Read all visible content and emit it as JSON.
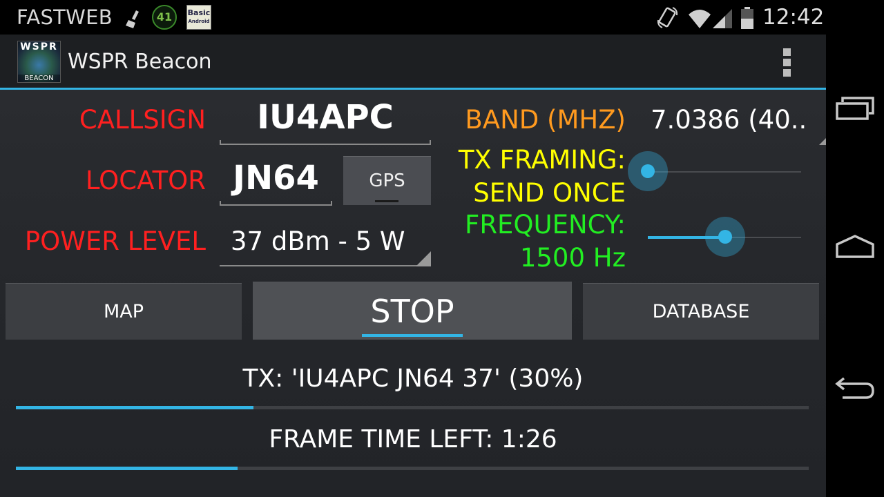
{
  "status_bar": {
    "carrier": "FASTWEB",
    "notification_badge": "41",
    "basic_android_icon": {
      "line1": "Basic",
      "line2": "Android"
    },
    "time": "12:42",
    "icons": [
      "broom-icon",
      "circle-badge-icon",
      "basic-android-icon",
      "rotate-phone-icon",
      "wifi-icon",
      "signal-icon",
      "battery-icon"
    ]
  },
  "action_bar": {
    "title": "WSPR Beacon",
    "logo_top": "WSPR",
    "logo_bottom": "BEACON",
    "menu_icon": "overflow-menu-icon"
  },
  "form": {
    "callsign_label": "CALLSIGN",
    "callsign_value": "IU4APC",
    "locator_label": "LOCATOR",
    "locator_value": "JN64",
    "gps_button": "GPS",
    "power_label": "POWER LEVEL",
    "power_value": "37 dBm - 5 W",
    "band_label": "BAND (MHZ)",
    "band_value": "7.0386 (40..",
    "framing_label_1": "TX FRAMING:",
    "framing_label_2": "SEND ONCE",
    "framing_slider_level": 0.0,
    "frequency_label_1": "FREQUENCY:",
    "frequency_label_2": "1500 Hz",
    "frequency_slider_level": 0.5
  },
  "buttons": {
    "map": "MAP",
    "stop": "STOP",
    "database": "DATABASE"
  },
  "status": {
    "tx_text": "TX: 'IU4APC JN64 37' (30%)",
    "tx_progress": 0.3,
    "frame_text": "FRAME TIME LEFT: 1:26",
    "frame_progress": 0.28
  },
  "colors": {
    "accent": "#33b5e5",
    "label_red": "#ff2020",
    "band_orange": "#ff9a1f",
    "framing_yellow": "#ffff00",
    "frequency_green": "#22ee22"
  },
  "nav_bar": {
    "icons": [
      "recent-apps-icon",
      "home-icon",
      "back-icon"
    ]
  }
}
